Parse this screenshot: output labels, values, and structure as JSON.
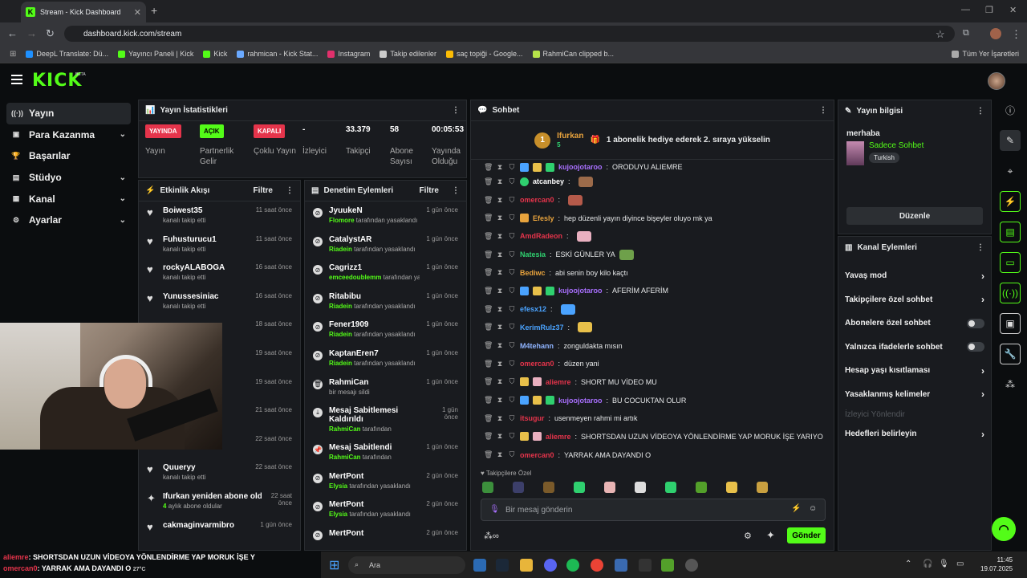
{
  "browser": {
    "tab_title": "Stream - Kick Dashboard",
    "url": "dashboard.kick.com/stream",
    "bookmarks": [
      "DeepL Translate: Dü...",
      "Yayıncı Paneli | Kick",
      "Kick",
      "rahmican - Kick Stat...",
      "Instagram",
      "Takip edilenler",
      "saç topiği - Google...",
      "RahmiCan clipped b..."
    ],
    "bookmarks_all": "Tüm Yer İşaretleri"
  },
  "brand": {
    "logo": "KICK",
    "beta": "BETA",
    "accent": "#53fc18"
  },
  "sidebar": {
    "items": [
      {
        "label": "Yayın"
      },
      {
        "label": "Para Kazanma"
      },
      {
        "label": "Başarılar"
      },
      {
        "label": "Stüdyo"
      },
      {
        "label": "Kanal"
      },
      {
        "label": "Ayarlar"
      }
    ]
  },
  "stats": {
    "title": "Yayın İstatistikleri",
    "cells": [
      {
        "pill": "YAYINDA",
        "label": "Yayın"
      },
      {
        "pill": "AÇIK",
        "label": "Partnerlik Gelir Programı"
      },
      {
        "pill": "KAPALI",
        "label": "Çoklu Yayın"
      },
      {
        "value": "-",
        "label": "İzleyici"
      },
      {
        "value": "33.379",
        "label": "Takipçi"
      },
      {
        "value": "58",
        "label": "Abone Sayısı"
      },
      {
        "value": "00:05:53",
        "label": "Yayında Olduğu Süre"
      }
    ]
  },
  "feed": {
    "title": "Etkinlik Akışı",
    "filter": "Filtre",
    "items": [
      {
        "name": "Boiwest35",
        "sub": "kanalı takip etti",
        "time": "11 saat önce"
      },
      {
        "name": "Fuhusturucu1",
        "sub": "kanalı takip etti",
        "time": "11 saat önce"
      },
      {
        "name": "rockyALABOGA",
        "sub": "kanalı takip etti",
        "time": "16 saat önce"
      },
      {
        "name": "Yunussesiniac",
        "sub": "kanalı takip etti",
        "time": "16 saat önce"
      },
      {
        "name": "",
        "sub": "",
        "time": "18 saat önce"
      },
      {
        "name": "",
        "sub": "",
        "time": "19 saat önce"
      },
      {
        "name": "",
        "sub": "",
        "time": "19 saat önce"
      },
      {
        "name": "",
        "sub": "",
        "time": "21 saat önce"
      },
      {
        "name": "",
        "sub": "kanalı takip etti",
        "time": "22 saat önce"
      },
      {
        "name": "Quueryy",
        "sub": "kanalı takip etti",
        "time": "22 saat önce"
      },
      {
        "name": "Ifurkan yeniden abone oldu!",
        "sub_green": "4",
        "sub": "aylık abone oldular",
        "time": "22 saat önce"
      },
      {
        "name": "cakmaginvarmibro",
        "sub": "",
        "time": "1 gün önce"
      }
    ]
  },
  "mod": {
    "title": "Denetim Eylemleri",
    "filter": "Filtre",
    "items": [
      {
        "name": "JyuukeN",
        "actor": "Flomore",
        "sub": "tarafından yasaklandı",
        "time": "1 gün önce"
      },
      {
        "name": "CatalystAR",
        "actor": "Riadein",
        "sub": "tarafından yasaklandı",
        "time": "1 gün önce"
      },
      {
        "name": "Cagrizz1",
        "actor": "emceedoublemm",
        "sub": "tarafından yasaklandı",
        "time": "1 gün önce"
      },
      {
        "name": "Ritabibu",
        "actor": "Riadein",
        "sub": "tarafından yasaklandı",
        "time": "1 gün önce"
      },
      {
        "name": "Fener1909",
        "actor": "Riadein",
        "sub": "tarafından yasaklandı",
        "time": "1 gün önce"
      },
      {
        "name": "KaptanEren7",
        "actor": "Riadein",
        "sub": "tarafından yasaklandı",
        "time": "1 gün önce"
      },
      {
        "name": "RahmiCan",
        "actor": "",
        "sub": "bir mesajı sildi",
        "time": "1 gün önce"
      },
      {
        "name": "Mesaj Sabitlemesi Kaldırıldı",
        "actor": "RahmiCan",
        "sub": "tarafından",
        "time": "1 gün önce"
      },
      {
        "name": "Mesaj Sabitlendi",
        "actor": "RahmiCan",
        "sub": "tarafından",
        "time": "1 gün önce"
      },
      {
        "name": "MertPont",
        "actor": "Elysia",
        "sub": "tarafından yasaklandı",
        "time": "2 gün önce"
      },
      {
        "name": "MertPont",
        "actor": "Elysia",
        "sub": "tarafından yasaklandı",
        "time": "2 gün önce"
      },
      {
        "name": "MertPont",
        "actor": "",
        "sub": "",
        "time": "2 gün önce"
      }
    ]
  },
  "chat": {
    "title": "Sohbet",
    "pinned": {
      "user": "Ifurkan",
      "count": "5",
      "rank": "1",
      "text": "1 abonelik hediye ederek 2. sıraya yükselin"
    },
    "messages": [
      {
        "user": "kujoojotaroo",
        "color": "#a970ff",
        "text": "ORODUYU ALIEMRE"
      },
      {
        "user": "atcanbey",
        "color": "#ffffff",
        "text": ""
      },
      {
        "user": "omercan0",
        "color": "#e5344b",
        "text": ""
      },
      {
        "user": "Efesly",
        "color": "#e8a33d",
        "text": "hep düzenli yayın diyince bişeyler oluyo mk ya"
      },
      {
        "user": "AmdRadeon",
        "color": "#e5344b",
        "text": ""
      },
      {
        "user": "Natesia",
        "color": "#2fd06f",
        "text": "ESKİ GÜNLER YA"
      },
      {
        "user": "Bediwc",
        "color": "#e8a33d",
        "text": "abi senin boy kilo kaçtı"
      },
      {
        "user": "kujoojotaroo",
        "color": "#a970ff",
        "text": "AFERİM AFERİM"
      },
      {
        "user": "efesx12",
        "color": "#4aa3ff",
        "text": ""
      },
      {
        "user": "KerimRulz37",
        "color": "#4aa3ff",
        "text": ""
      },
      {
        "user": "M4tehann",
        "color": "#8fb4ff",
        "text": "zonguldakta mısın"
      },
      {
        "user": "omercan0",
        "color": "#e5344b",
        "text": "düzen yani"
      },
      {
        "user": "aliemre",
        "color": "#e5344b",
        "text": "SHORT MU VİDEO MU"
      },
      {
        "user": "kujoojotaroo",
        "color": "#a970ff",
        "text": "BU COCUKTAN OLUR"
      },
      {
        "user": "itsugur",
        "color": "#e5344b",
        "text": "usenmeyen rahmi mi artık"
      },
      {
        "user": "aliemre",
        "color": "#e5344b",
        "text": "SHORTSDAN UZUN VİDEOYA YÖNLENDİRME YAP MORUK İŞE YARIYO"
      },
      {
        "user": "omercan0",
        "color": "#e5344b",
        "text": "YARRAK AMA DAYANDI O"
      }
    ],
    "followers_only": "Takipçilere Özel",
    "placeholder": "Bir mesaj gönderin",
    "send": "Gönder"
  },
  "info": {
    "title": "Yayın bilgisi",
    "stream_title": "merhaba",
    "category": "Sadece Sohbet",
    "tag": "Turkish",
    "edit": "Düzenle"
  },
  "actions": {
    "title": "Kanal Eylemleri",
    "items": [
      {
        "label": "Yavaş mod",
        "kind": "chev"
      },
      {
        "label": "Takipçilere özel sohbet",
        "kind": "chev"
      },
      {
        "label": "Abonelere özel sohbet",
        "kind": "toggle"
      },
      {
        "label": "Yalnızca ifadelerle sohbet",
        "kind": "toggle"
      },
      {
        "label": "Hesap yaşı kısıtlaması",
        "kind": "chev"
      },
      {
        "label": "Yasaklanmış kelimeler",
        "kind": "chev"
      },
      {
        "label": "İzleyici Yönlendir",
        "kind": "disabled"
      },
      {
        "label": "Hedefleri belirleyin",
        "kind": "chev"
      }
    ]
  },
  "overlay": {
    "line1_user": "aliemre",
    "line1": ": SHORTSDAN UZUN VİDEOYA YÖNLENDİRME YAP MORUK İŞE Y",
    "line2_user": "omercan0",
    "line2": ": YARRAK AMA DAYANDI O",
    "temp": "27°C"
  },
  "taskbar": {
    "search": "Ara",
    "time": "11:45",
    "date": "19.07.2025"
  }
}
